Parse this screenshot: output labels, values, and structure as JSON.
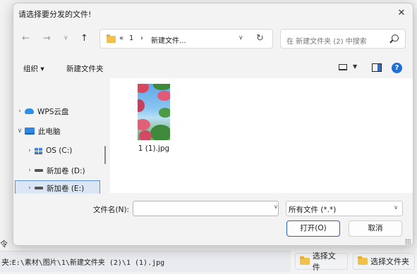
{
  "background_app": {
    "side_label": "令",
    "path_label": "夹:",
    "path_value": "E:\\素材\\图片\\1\\新建文件夹 (2)\\1 (1).jpg",
    "select_file_button": "选择文件",
    "select_folder_button": "选择文件夹"
  },
  "dialog": {
    "title": "请选择要分发的文件!",
    "address": {
      "overflow": "«",
      "crumb1": "1",
      "separator": "›",
      "crumb2": "新建文件..."
    },
    "search_placeholder": "在 新建文件夹 (2) 中搜索",
    "toolbar": {
      "organize": "组织 ▾",
      "new_folder": "新建文件夹"
    },
    "nav_pane": [
      {
        "label": "WPS云盘",
        "icon": "cloud-icon",
        "expanded": false
      },
      {
        "label": "此电脑",
        "icon": "pc-icon",
        "expanded": true
      },
      {
        "label": "OS (C:)",
        "icon": "windows-drive-icon",
        "expanded": false
      },
      {
        "label": "新加卷 (D:)",
        "icon": "drive-icon",
        "expanded": false
      },
      {
        "label": "新加卷 (E:)",
        "icon": "drive-icon",
        "expanded": false,
        "selected": true
      }
    ],
    "files": [
      {
        "name": "1 (1).jpg",
        "icon": "image-thumbnail"
      }
    ],
    "filename_label": "文件名(N):",
    "filename_value": "",
    "filetype_value": "所有文件 (*.*)",
    "open_button": "打开(O)",
    "cancel_button": "取消"
  },
  "colors": {
    "accent": "#2a62c4",
    "selection_bg": "#dbe6f4",
    "folder": "#f2c14b"
  }
}
